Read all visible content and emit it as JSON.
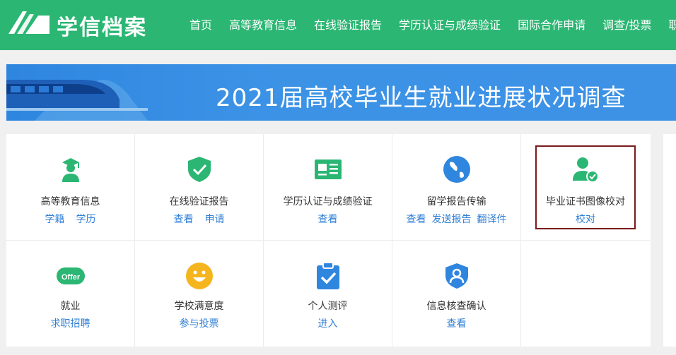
{
  "header": {
    "brand": "学信档案",
    "nav": [
      "首页",
      "高等教育信息",
      "在线验证报告",
      "学历认证与成绩验证",
      "国际合作申请",
      "调查/投票",
      "职"
    ]
  },
  "banner": {
    "title": "2021届高校毕业生就业进展状况调查"
  },
  "services": [
    {
      "title": "高等教育信息",
      "links": [
        "学籍",
        "学历"
      ],
      "icon": "graduate-icon"
    },
    {
      "title": "在线验证报告",
      "links": [
        "查看",
        "申请"
      ],
      "icon": "shield-check-icon"
    },
    {
      "title": "学历认证与成绩验证",
      "links": [
        "查看"
      ],
      "icon": "id-card-icon"
    },
    {
      "title": "留学报告传输",
      "links": [
        "查看",
        "发送报告",
        "翻译件"
      ],
      "icon": "globe-icon"
    },
    {
      "title": "毕业证书图像校对",
      "links": [
        "校对"
      ],
      "icon": "user-check-icon"
    },
    {
      "title": "就业",
      "links": [
        "求职招聘"
      ],
      "icon": "offer-icon",
      "badge": "Offer"
    },
    {
      "title": "学校满意度",
      "links": [
        "参与投票"
      ],
      "icon": "smiley-icon"
    },
    {
      "title": "个人测评",
      "links": [
        "进入"
      ],
      "icon": "clipboard-check-icon"
    },
    {
      "title": "信息核查确认",
      "links": [
        "查看"
      ],
      "icon": "shield-user-icon"
    }
  ],
  "colors": {
    "header_bg": "#2bb673",
    "banner_bg": "#3c93e6",
    "icon_green": "#2bb673",
    "icon_blue": "#2f86df",
    "icon_yellow": "#f5b51e",
    "link": "#2f7fd6",
    "highlight": "#7a1a1a"
  }
}
